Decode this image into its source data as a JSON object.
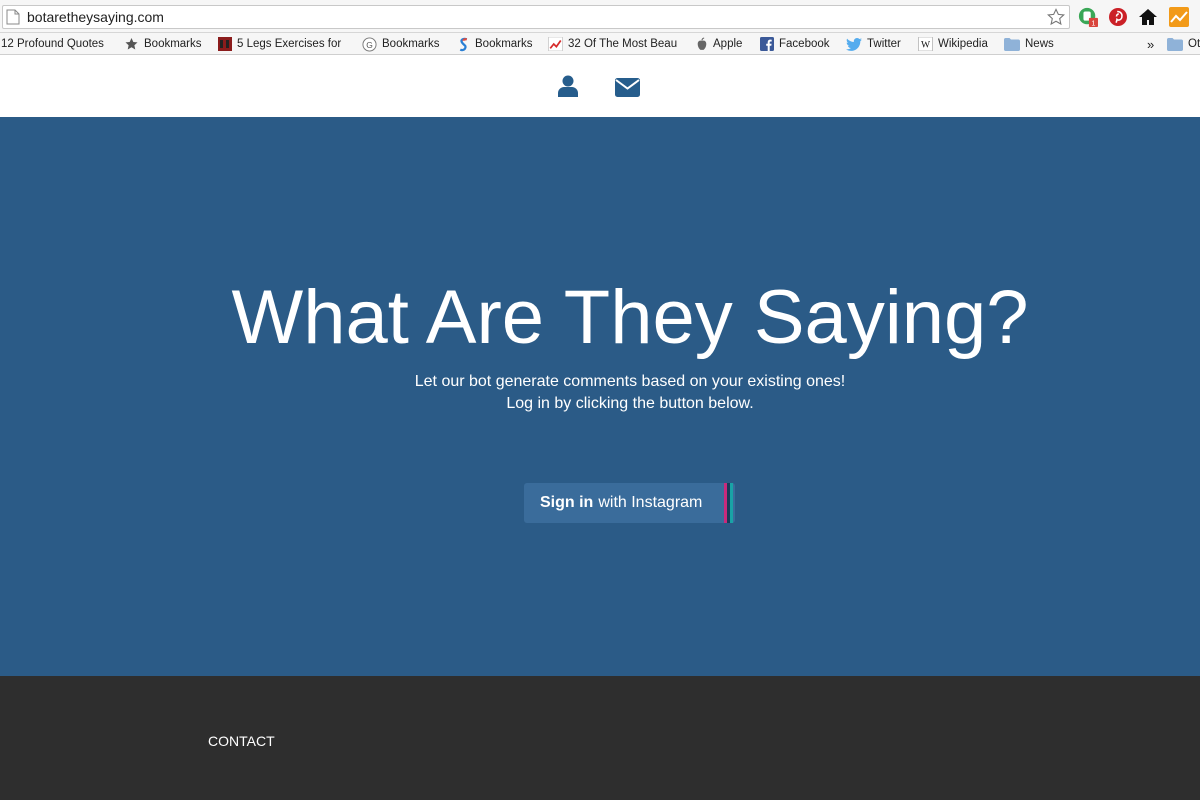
{
  "browser": {
    "url": "botaretheysaying.com",
    "bookmarks": [
      {
        "label": "12 Profound Quotes",
        "icon": "bookmark-page-icon"
      },
      {
        "label": "Bookmarks",
        "icon": "star-icon"
      },
      {
        "label": "5 Legs Exercises for",
        "icon": "favicon-icon"
      },
      {
        "label": "Bookmarks",
        "icon": "g-icon"
      },
      {
        "label": "Bookmarks",
        "icon": "s-icon"
      },
      {
        "label": "32 Of The Most Beau",
        "icon": "chart-icon"
      },
      {
        "label": "Apple",
        "icon": "apple-icon"
      },
      {
        "label": "Facebook",
        "icon": "facebook-icon"
      },
      {
        "label": "Twitter",
        "icon": "twitter-icon"
      },
      {
        "label": "Wikipedia",
        "icon": "wikipedia-icon"
      },
      {
        "label": "News",
        "icon": "folder-icon"
      }
    ],
    "overflow_label": "»",
    "other_bookmarks_label": "Ot",
    "extension_badge": "1"
  },
  "nav": {
    "icons": [
      "user-icon",
      "envelope-icon"
    ]
  },
  "hero": {
    "title": "What Are They Saying?",
    "subtitle_line1": "Let our bot generate comments based on your existing ones!",
    "subtitle_line2": "Log in by clicking the button below.",
    "signin_bold": "Sign in",
    "signin_rest": "with Instagram"
  },
  "footer": {
    "contact_label": "CONTACT"
  },
  "colors": {
    "hero_bg": "#2b5b87",
    "button_bg": "#3a6c9b",
    "footer_bg": "#2e2e2e",
    "icon_blue": "#265d8c"
  }
}
